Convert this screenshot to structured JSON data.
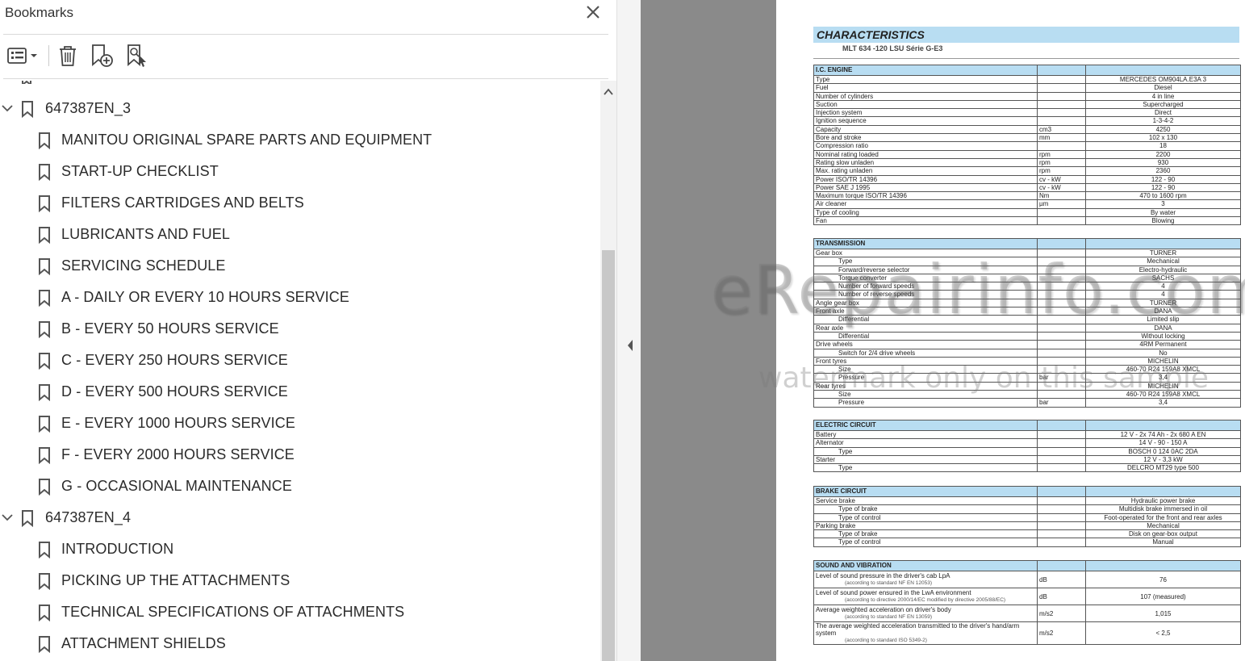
{
  "panel": {
    "title": "Bookmarks",
    "close_icon": "close-icon"
  },
  "toolbar": {
    "options_icon": "options-list-icon",
    "delete_icon": "trash-icon",
    "new_bookmark_icon": "new-bookmark-icon",
    "add_from_structure_icon": "bookmark-search-icon"
  },
  "tree": {
    "items": [
      {
        "level": 1,
        "label": "647387EN_3",
        "expanded": true
      },
      {
        "level": 2,
        "label": "MANITOU ORIGINAL SPARE PARTS AND EQUIPMENT"
      },
      {
        "level": 2,
        "label": "START-UP CHECKLIST"
      },
      {
        "level": 2,
        "label": "FILTERS CARTRIDGES AND BELTS"
      },
      {
        "level": 2,
        "label": "LUBRICANTS AND FUEL"
      },
      {
        "level": 2,
        "label": "SERVICING SCHEDULE"
      },
      {
        "level": 2,
        "label": "A - DAILY OR EVERY 10 HOURS SERVICE"
      },
      {
        "level": 2,
        "label": "B - EVERY 50 HOURS SERVICE"
      },
      {
        "level": 2,
        "label": "C - EVERY 250 HOURS SERVICE"
      },
      {
        "level": 2,
        "label": "D - EVERY 500 HOURS SERVICE"
      },
      {
        "level": 2,
        "label": "E - EVERY 1000 HOURS SERVICE"
      },
      {
        "level": 2,
        "label": "F - EVERY 2000 HOURS SERVICE"
      },
      {
        "level": 2,
        "label": "G - OCCASIONAL MAINTENANCE"
      },
      {
        "level": 1,
        "label": "647387EN_4",
        "expanded": true
      },
      {
        "level": 2,
        "label": "INTRODUCTION"
      },
      {
        "level": 2,
        "label": "PICKING UP THE ATTACHMENTS"
      },
      {
        "level": 2,
        "label": "TECHNICAL SPECIFICATIONS OF ATTACHMENTS"
      },
      {
        "level": 2,
        "label": "ATTACHMENT SHIELDS"
      }
    ]
  },
  "document": {
    "title": "CHARACTERISTICS",
    "model": "MLT 634 -120 LSU Série G-E3",
    "engine": {
      "header": "I.C. ENGINE",
      "rows": [
        {
          "label": "Type",
          "unit": "",
          "value": "MERCEDES OM904LA.E3A 3"
        },
        {
          "label": "Fuel",
          "unit": "",
          "value": "Diesel"
        },
        {
          "label": "Number of cylinders",
          "unit": "",
          "value": "4 in line"
        },
        {
          "label": "Suction",
          "unit": "",
          "value": "Supercharged"
        },
        {
          "label": "Injection system",
          "unit": "",
          "value": "Direct"
        },
        {
          "label": "Ignition sequence",
          "unit": "",
          "value": "1-3-4-2"
        },
        {
          "label": "Capacity",
          "unit": "cm3",
          "value": "4250"
        },
        {
          "label": "Bore and stroke",
          "unit": "mm",
          "value": "102 x 130"
        },
        {
          "label": "Compression ratio",
          "unit": "",
          "value": "18"
        },
        {
          "label": "Nominal rating loaded",
          "unit": "rpm",
          "value": "2200"
        },
        {
          "label": "Rating slow unladen",
          "unit": "rpm",
          "value": "930"
        },
        {
          "label": "Max. rating unladen",
          "unit": "rpm",
          "value": "2360"
        },
        {
          "label": "Power ISO/TR 14396",
          "unit": "cv - kW",
          "value": "122 - 90"
        },
        {
          "label": "Power SAE J 1995",
          "unit": "cv - kW",
          "value": "122 - 90"
        },
        {
          "label": "Maximum torque ISO/TR 14396",
          "unit": "Nm",
          "value": "470 to 1600 rpm"
        },
        {
          "label": "Air cleaner",
          "unit": "µm",
          "value": "3"
        },
        {
          "label": "Type of cooling",
          "unit": "",
          "value": "By water"
        },
        {
          "label": "Fan",
          "unit": "",
          "value": "Blowing"
        }
      ]
    },
    "transmission": {
      "header": "TRANSMISSION",
      "rows": [
        {
          "label": "Gear box",
          "unit": "",
          "value": "TURNER",
          "sub": false
        },
        {
          "label": "Type",
          "unit": "",
          "value": "Mechanical",
          "sub": true
        },
        {
          "label": "Forward/reverse selector",
          "unit": "",
          "value": "Electro-hydraulic",
          "sub": true
        },
        {
          "label": "Torque converter",
          "unit": "",
          "value": "SACHS",
          "sub": true
        },
        {
          "label": "Number of forward speeds",
          "unit": "",
          "value": "4",
          "sub": true
        },
        {
          "label": "Number of reverse speeds",
          "unit": "",
          "value": "4",
          "sub": true
        },
        {
          "label": "Angle gear box",
          "unit": "",
          "value": "TURNER",
          "sub": false
        },
        {
          "label": "Front axle",
          "unit": "",
          "value": "DANA",
          "sub": false
        },
        {
          "label": "Differential",
          "unit": "",
          "value": "Limited slip",
          "sub": true
        },
        {
          "label": "Rear axle",
          "unit": "",
          "value": "DANA",
          "sub": false
        },
        {
          "label": "Differential",
          "unit": "",
          "value": "Without locking",
          "sub": true
        },
        {
          "label": "Drive wheels",
          "unit": "",
          "value": "4RM Permanent",
          "sub": false
        },
        {
          "label": "Switch for 2/4 drive wheels",
          "unit": "",
          "value": "No",
          "sub": true
        },
        {
          "label": "Front tyres",
          "unit": "",
          "value": "MICHELIN",
          "sub": false
        },
        {
          "label": "Size",
          "unit": "",
          "value": "460-70 R24 159A8 XMCL",
          "sub": true
        },
        {
          "label": "Pressure",
          "unit": "bar",
          "value": "3,4",
          "sub": true
        },
        {
          "label": "Rear tyres",
          "unit": "",
          "value": "MICHELIN",
          "sub": false
        },
        {
          "label": "Size",
          "unit": "",
          "value": "460-70 R24 159A8 XMCL",
          "sub": true
        },
        {
          "label": "Pressure",
          "unit": "bar",
          "value": "3,4",
          "sub": true
        }
      ]
    },
    "electric": {
      "header": "ELECTRIC CIRCUIT",
      "rows": [
        {
          "label": "Battery",
          "unit": "",
          "value": "12 V - 2x 74 Ah - 2x 680 A EN",
          "sub": false
        },
        {
          "label": "Alternator",
          "unit": "",
          "value": "14 V - 90 - 150 A",
          "sub": false
        },
        {
          "label": "Type",
          "unit": "",
          "value": "BOSCH 0 124 0AC 2DA",
          "sub": true
        },
        {
          "label": "Starter",
          "unit": "",
          "value": "12 V - 3,3 kW",
          "sub": false
        },
        {
          "label": "Type",
          "unit": "",
          "value": "DELCRO MT29 type 500",
          "sub": true
        }
      ]
    },
    "brake": {
      "header": "BRAKE CIRCUIT",
      "rows": [
        {
          "label": "Service brake",
          "unit": "",
          "value": "Hydraulic power brake",
          "sub": false
        },
        {
          "label": "Type of brake",
          "unit": "",
          "value": "Multidisk brake immersed in oil",
          "sub": true
        },
        {
          "label": "Type of control",
          "unit": "",
          "value": "Foot-operated for the front and rear axles",
          "sub": true
        },
        {
          "label": "Parking brake",
          "unit": "",
          "value": "Mechanical",
          "sub": false
        },
        {
          "label": "Type of brake",
          "unit": "",
          "value": "Disk on gear-box output",
          "sub": true
        },
        {
          "label": "Type of control",
          "unit": "",
          "value": "Manual",
          "sub": true
        }
      ]
    },
    "sound": {
      "header": "SOUND AND VIBRATION",
      "rows": [
        {
          "label": "Level of sound pressure in the driver's cab LpA",
          "note": "(according to standard NF EN 12053)",
          "unit": "dB",
          "value": "76"
        },
        {
          "label": "Level of sound power ensured in the LwA environment",
          "note": "(according to directive 2000/14/EC modified by directive 2005/88/EC)",
          "unit": "dB",
          "value": "107 (measured)"
        },
        {
          "label": "Average weighted acceleration on driver's body",
          "note": "(according to standard NF EN 13059)",
          "unit": "m/s2",
          "value": "1,015"
        },
        {
          "label": "The average weighted acceleration transmitted to the driver's hand/arm system",
          "note": "(according to standard ISO 5349-2)",
          "unit": "m/s2",
          "value": "< 2,5"
        }
      ]
    }
  },
  "watermark": {
    "main": "eRepairinfo.com",
    "sub": "watermark only on this sample"
  },
  "colors": {
    "accent_blue": "#b8ddf2",
    "gutter_gray": "#8a8a8a"
  }
}
